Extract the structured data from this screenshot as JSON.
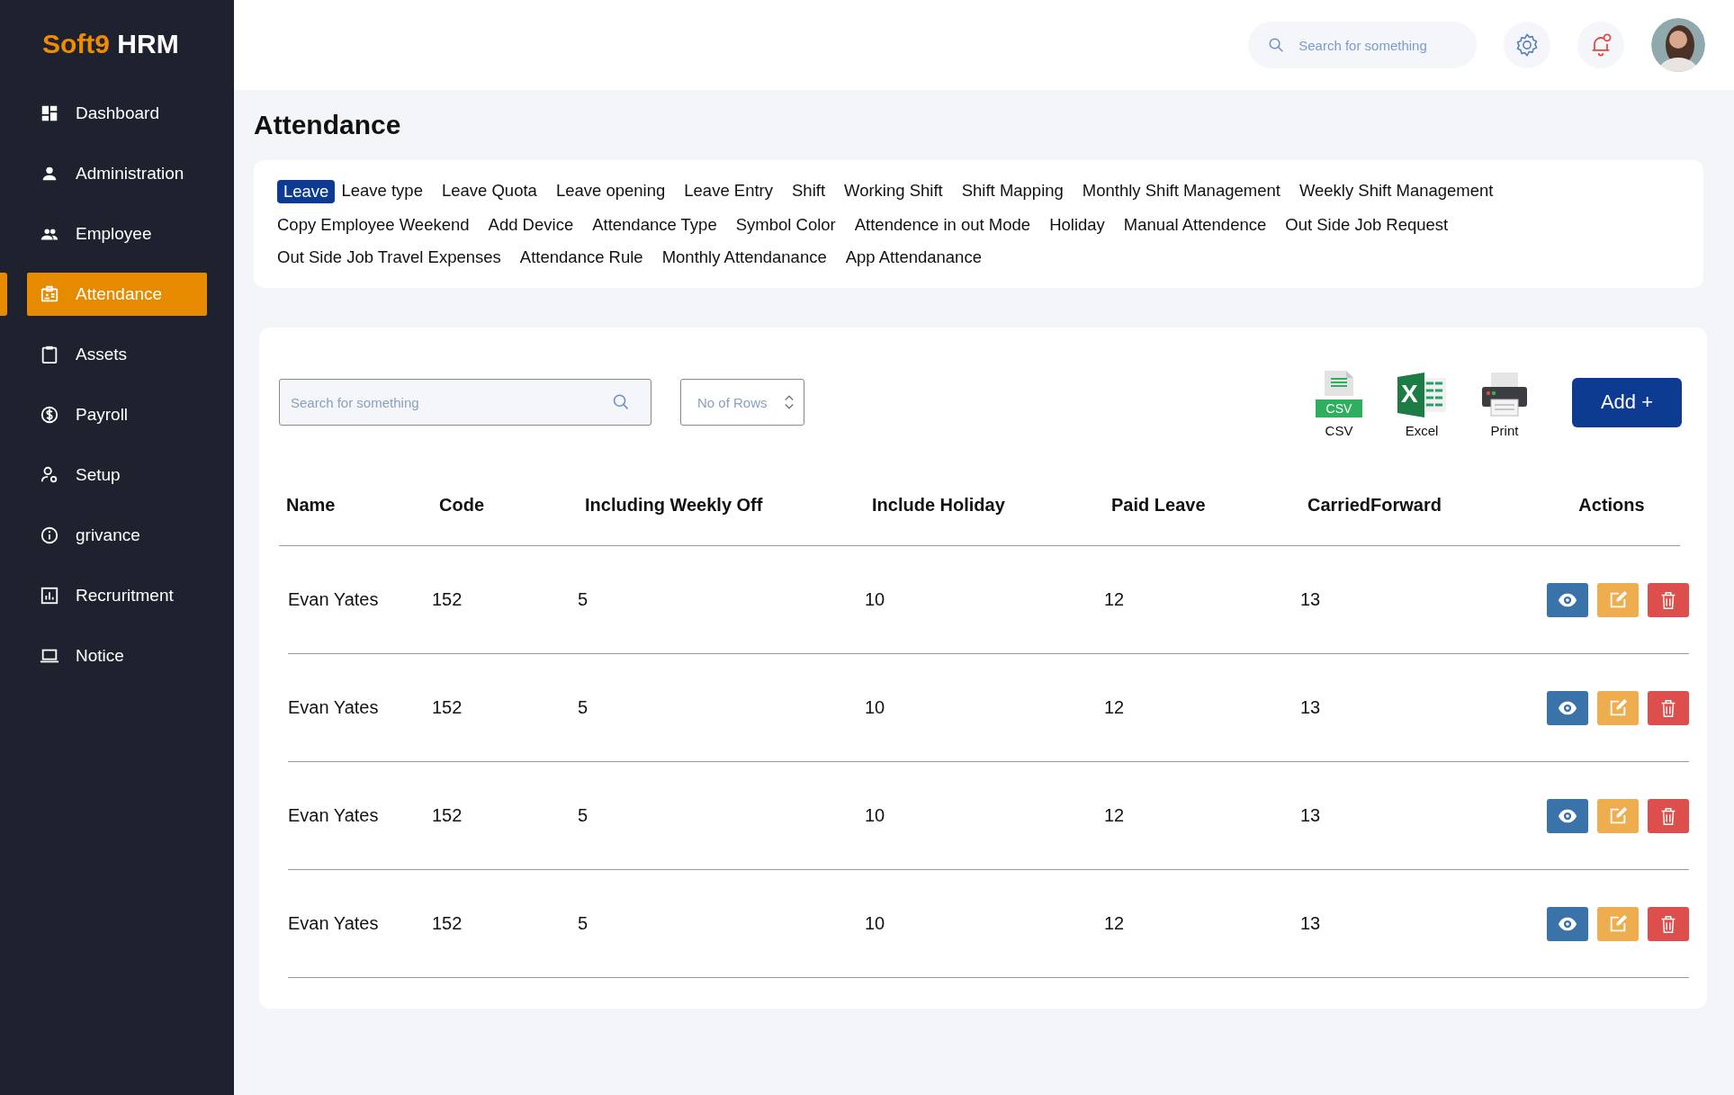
{
  "brand": {
    "primary": "Soft9",
    "secondary": "HRM"
  },
  "sidebar": {
    "items": [
      {
        "label": "Dashboard",
        "selected": false
      },
      {
        "label": "Administration",
        "selected": false
      },
      {
        "label": "Employee",
        "selected": false
      },
      {
        "label": "Attendance",
        "selected": true
      },
      {
        "label": "Assets",
        "selected": false
      },
      {
        "label": "Payroll",
        "selected": false
      },
      {
        "label": "Setup",
        "selected": false
      },
      {
        "label": "grivance",
        "selected": false
      },
      {
        "label": "Recruritment",
        "selected": false
      },
      {
        "label": "Notice",
        "selected": false
      }
    ]
  },
  "topbar": {
    "search": {
      "placeholder": "Search for something"
    },
    "notification_unread": true
  },
  "page_title": "Attendance",
  "tabs": [
    {
      "label": "Leave",
      "selected": true
    },
    {
      "label": "Leave type",
      "selected": false
    },
    {
      "label": "Leave Quota",
      "selected": false
    },
    {
      "label": "Leave opening",
      "selected": false
    },
    {
      "label": "Leave Entry",
      "selected": false
    },
    {
      "label": "Shift",
      "selected": false
    },
    {
      "label": "Working Shift",
      "selected": false
    },
    {
      "label": "Shift Mapping",
      "selected": false
    },
    {
      "label": "Monthly Shift Management",
      "selected": false
    },
    {
      "label": "Weekly Shift Management",
      "selected": false
    },
    {
      "label": "Copy Employee Weekend",
      "selected": false
    },
    {
      "label": "Add Device",
      "selected": false
    },
    {
      "label": "Attendance Type",
      "selected": false
    },
    {
      "label": "Symbol Color",
      "selected": false
    },
    {
      "label": "Attendence in out Mode",
      "selected": false
    },
    {
      "label": "Holiday",
      "selected": false
    },
    {
      "label": "Manual Attendence",
      "selected": false
    },
    {
      "label": "Out Side Job Request",
      "selected": false
    },
    {
      "label": "Out Side Job Travel Expenses",
      "selected": false
    },
    {
      "label": "Attendance Rule",
      "selected": false
    },
    {
      "label": "Monthly Attendanance",
      "selected": false
    },
    {
      "label": "App Attendanance",
      "selected": false
    }
  ],
  "toolbar": {
    "search": {
      "placeholder": "Search for something"
    },
    "rows_select": {
      "placeholder": "No of Rows"
    },
    "exports": [
      {
        "kind": "csv",
        "icon_text": "CSV",
        "label": "CSV"
      },
      {
        "kind": "excel",
        "icon_text": "X",
        "label": "Excel"
      },
      {
        "kind": "print",
        "label": "Print"
      }
    ],
    "add_button": "Add +"
  },
  "table": {
    "columns": [
      "Name",
      "Code",
      "Including Weekly Off",
      "Include Holiday",
      "Paid Leave",
      "CarriedForward",
      "Actions"
    ],
    "rows": [
      [
        "Evan Yates",
        "152",
        "5",
        "10",
        "12",
        "13"
      ],
      [
        "Evan Yates",
        "152",
        "5",
        "10",
        "12",
        "13"
      ],
      [
        "Evan Yates",
        "152",
        "5",
        "10",
        "12",
        "13"
      ],
      [
        "Evan Yates",
        "152",
        "5",
        "10",
        "12",
        "13"
      ]
    ],
    "row_actions": [
      {
        "kind": "view"
      },
      {
        "kind": "edit"
      },
      {
        "kind": "delete"
      }
    ]
  }
}
